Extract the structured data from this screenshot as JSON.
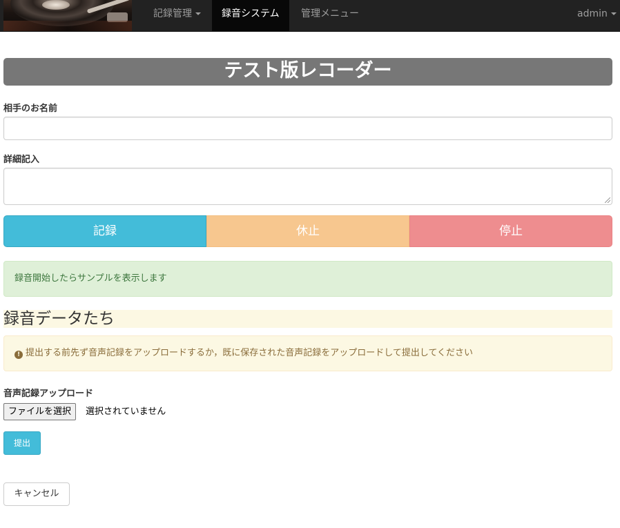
{
  "navbar": {
    "logo_icon": "turntable-logo",
    "items": [
      {
        "label": "記録管理",
        "dropdown": true
      },
      {
        "label": "録音システム",
        "active": true
      },
      {
        "label": "管理メニュー"
      }
    ],
    "user": "admin"
  },
  "page": {
    "title": "テスト版レコーダー"
  },
  "form": {
    "name_label": "相手のお名前",
    "name_value": "",
    "detail_label": "詳細記入",
    "detail_value": ""
  },
  "controls": {
    "record_label": "記録",
    "pause_label": "休止",
    "stop_label": "停止",
    "colors": {
      "record": "#43bcd9",
      "pause": "#f7c78f",
      "stop": "#ee8d8f"
    }
  },
  "status": {
    "message": "録音開始したらサンプルを表示します"
  },
  "recordings": {
    "heading": "録音データたち",
    "warning": "提出する前先ず音声記録をアップロードするか，既に保存された音声記録をアップロードして提出してください",
    "warning_icon": "exclamation-circle-icon"
  },
  "upload": {
    "label": "音声記録アップロード",
    "file_button": "ファイルを選択",
    "file_status": "選択されていません",
    "submit_label": "提出",
    "cancel_label": "キャンセル"
  }
}
